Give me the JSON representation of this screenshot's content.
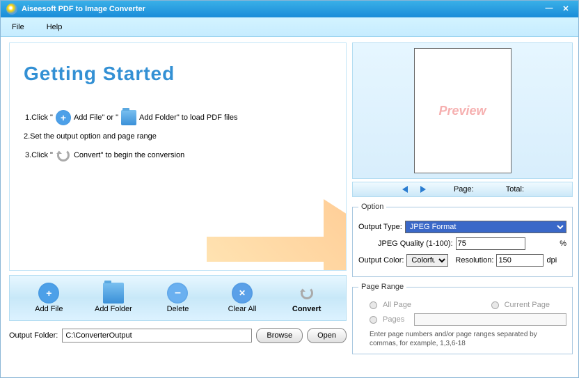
{
  "title": "Aiseesoft PDF to Image Converter",
  "menu": {
    "file": "File",
    "help": "Help"
  },
  "gs": {
    "heading": "Getting Started",
    "l1a": "1.Click \"",
    "l1b": " Add File\" or \"",
    "l1c": " Add Folder\" to load PDF files",
    "l2": "2.Set the output option and page range",
    "l3a": "3.Click \"",
    "l3b": " Convert\" to begin the conversion"
  },
  "toolbar": {
    "addfile": "Add File",
    "addfolder": "Add Folder",
    "delete": "Delete",
    "clearall": "Clear All",
    "convert": "Convert"
  },
  "output": {
    "label": "Output Folder:",
    "path": "C:\\ConverterOutput",
    "browse": "Browse",
    "open": "Open"
  },
  "preview": {
    "text": "Preview",
    "page": "Page:",
    "total": "Total:"
  },
  "option": {
    "legend": "Option",
    "outtype_lbl": "Output Type:",
    "outtype_val": "JPEG Format",
    "qual_lbl": "JPEG Quality (1-100):",
    "qual_val": "75",
    "qual_pct": "%",
    "outcolor_lbl": "Output Color:",
    "outcolor_val": "Colorfull",
    "res_lbl": "Resolution:",
    "res_val": "150",
    "res_unit": "dpi"
  },
  "range": {
    "legend": "Page Range",
    "all": "All Page",
    "current": "Current Page",
    "pages": "Pages",
    "hint": "Enter page numbers and/or page ranges separated by commas, for example, 1,3,6-18"
  }
}
